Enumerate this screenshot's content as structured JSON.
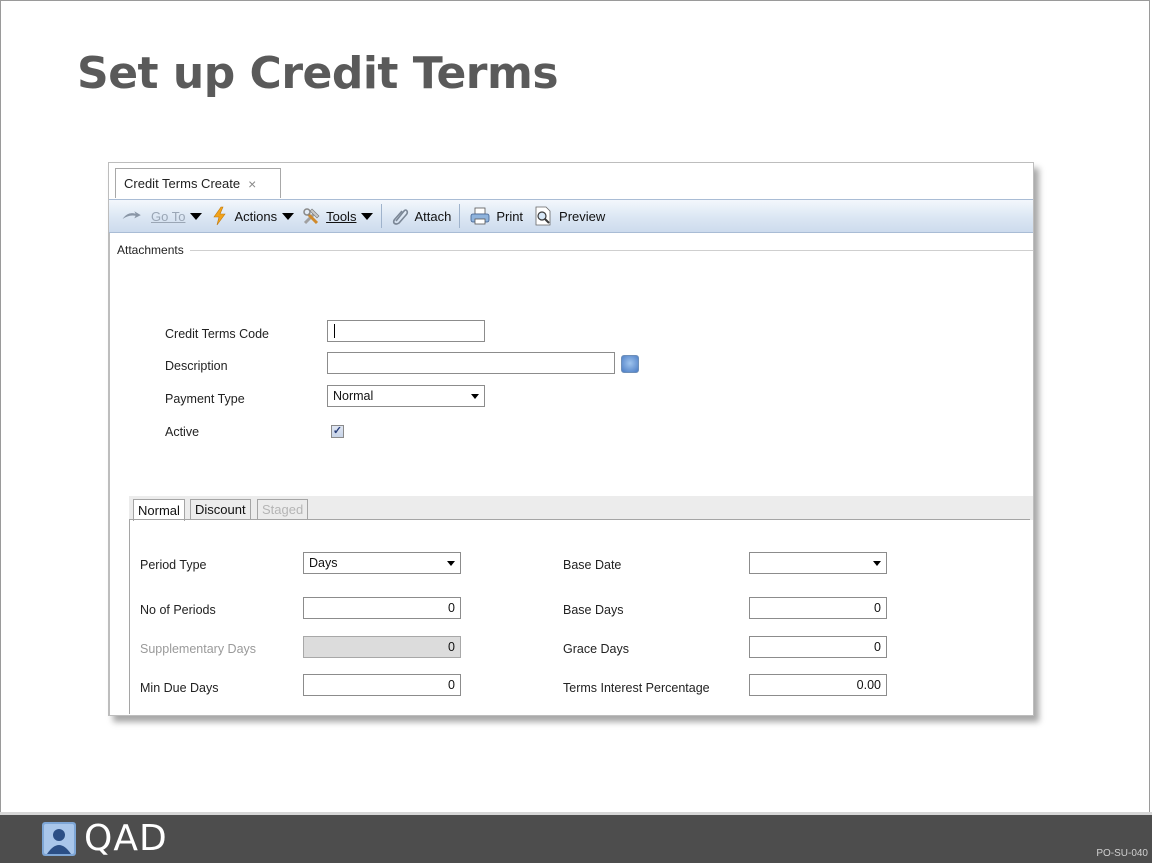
{
  "slide": {
    "title": "Set up Credit Terms",
    "code": "PO-SU-040"
  },
  "logo": {
    "text": "QAD"
  },
  "window": {
    "tab_label": "Credit Terms Create",
    "tab_close": "×",
    "toolbar": {
      "goto": "Go To",
      "actions": "Actions",
      "tools": "Tools",
      "attach": "Attach",
      "print": "Print",
      "preview": "Preview"
    },
    "attachments_label": "Attachments",
    "form": {
      "credit_terms_code": {
        "label": "Credit Terms Code",
        "value": ""
      },
      "description": {
        "label": "Description",
        "value": ""
      },
      "payment_type": {
        "label": "Payment Type",
        "value": "Normal"
      },
      "active": {
        "label": "Active",
        "checked": true,
        "mark": "✓"
      }
    },
    "subtabs": [
      "Normal",
      "Discount",
      "Staged"
    ],
    "normal_tab": {
      "period_type": {
        "label": "Period Type",
        "value": "Days"
      },
      "no_of_periods": {
        "label": "No of Periods",
        "value": "0"
      },
      "supplementary_days": {
        "label": "Supplementary Days",
        "value": "0"
      },
      "min_due_days": {
        "label": "Min Due Days",
        "value": "0"
      },
      "base_date": {
        "label": "Base Date",
        "value": ""
      },
      "base_days": {
        "label": "Base Days",
        "value": "0"
      },
      "grace_days": {
        "label": "Grace Days",
        "value": "0"
      },
      "terms_interest_percentage": {
        "label": "Terms Interest Percentage",
        "value": "0.00"
      }
    }
  }
}
